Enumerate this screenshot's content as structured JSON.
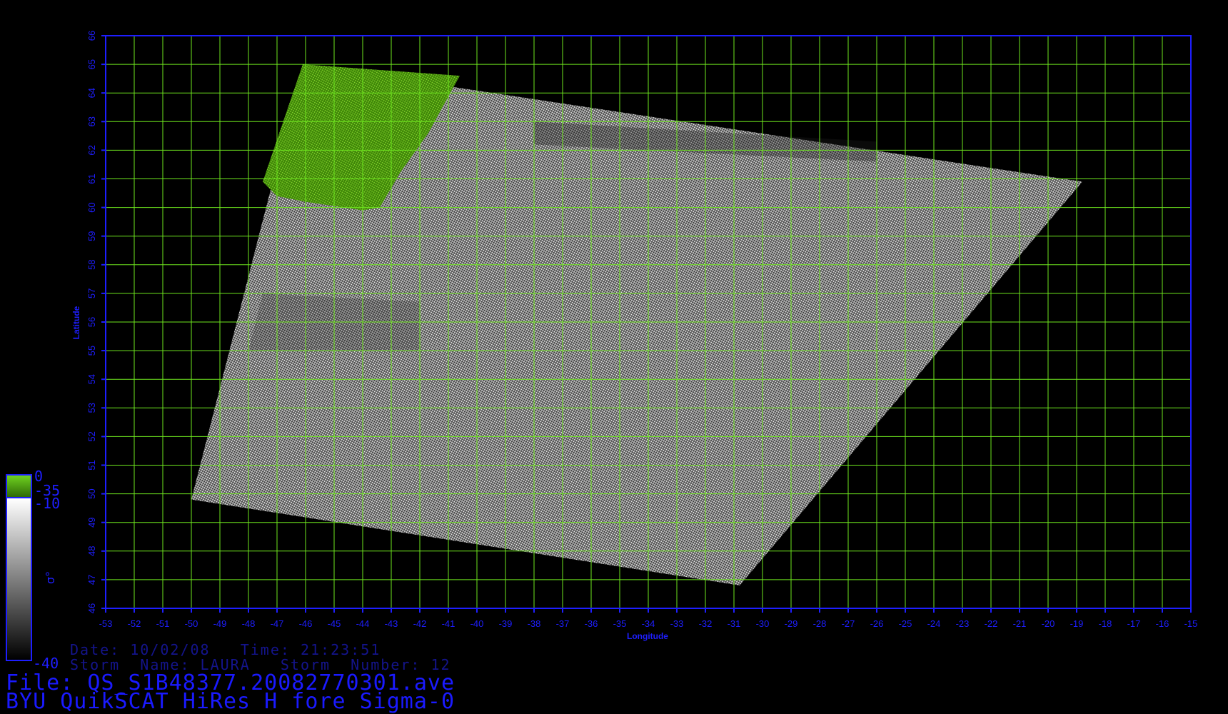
{
  "plot": {
    "xlabel": "Longitude",
    "ylabel": "Latitude",
    "lon_range": [
      -53,
      -15
    ],
    "lat_range": [
      46,
      66
    ],
    "lon_ticks": [
      "-53",
      "-52",
      "-51",
      "-50",
      "-49",
      "-48",
      "-47",
      "-46",
      "-45",
      "-44",
      "-43",
      "-42",
      "-41",
      "-40",
      "-39",
      "-38",
      "-37",
      "-36",
      "-35",
      "-34",
      "-33",
      "-32",
      "-31",
      "-30",
      "-29",
      "-28",
      "-27",
      "-26",
      "-25",
      "-24",
      "-23",
      "-22",
      "-21",
      "-20",
      "-19",
      "-18",
      "-17",
      "-16",
      "-15"
    ],
    "lat_ticks": [
      "46",
      "47",
      "48",
      "49",
      "50",
      "51",
      "52",
      "53",
      "54",
      "55",
      "56",
      "57",
      "58",
      "59",
      "60",
      "61",
      "62",
      "63",
      "64",
      "65",
      "66"
    ],
    "grid": true,
    "colors": {
      "axis": "#1e1eff",
      "grid": "#6ee61e",
      "land": "#4f9a0e",
      "background": "#000000"
    },
    "swath_corners_lonlat": [
      [
        -46.1,
        65.0
      ],
      [
        -18.8,
        60.9
      ],
      [
        -30.8,
        46.8
      ],
      [
        -50.0,
        49.8
      ]
    ],
    "land_region_lonlat": [
      [
        -46.1,
        65.0
      ],
      [
        -40.6,
        64.6
      ],
      [
        -41.7,
        62.6
      ],
      [
        -42.7,
        61.2
      ],
      [
        -43.4,
        60.0
      ],
      [
        -44.0,
        59.9
      ],
      [
        -46.0,
        60.2
      ],
      [
        -47.0,
        60.4
      ],
      [
        -47.5,
        60.9
      ]
    ]
  },
  "colorbar": {
    "labels": [
      "0",
      "-35",
      "-10",
      "-40"
    ],
    "symbol": "σ°",
    "colors": {
      "top": "#4fb810",
      "white": "#ffffff",
      "black": "#000000",
      "frame": "#1e1eff"
    }
  },
  "captions": {
    "date_line": "Date: 10/02/08   Time: 21:23:51",
    "storm_line": "Storm  Name: LAURA   Storm  Number: 12",
    "file_line": "File: QS_S1B48377.20082770301.ave",
    "product_line": "BYU QuikSCAT HiRes H fore Sigma-0"
  }
}
